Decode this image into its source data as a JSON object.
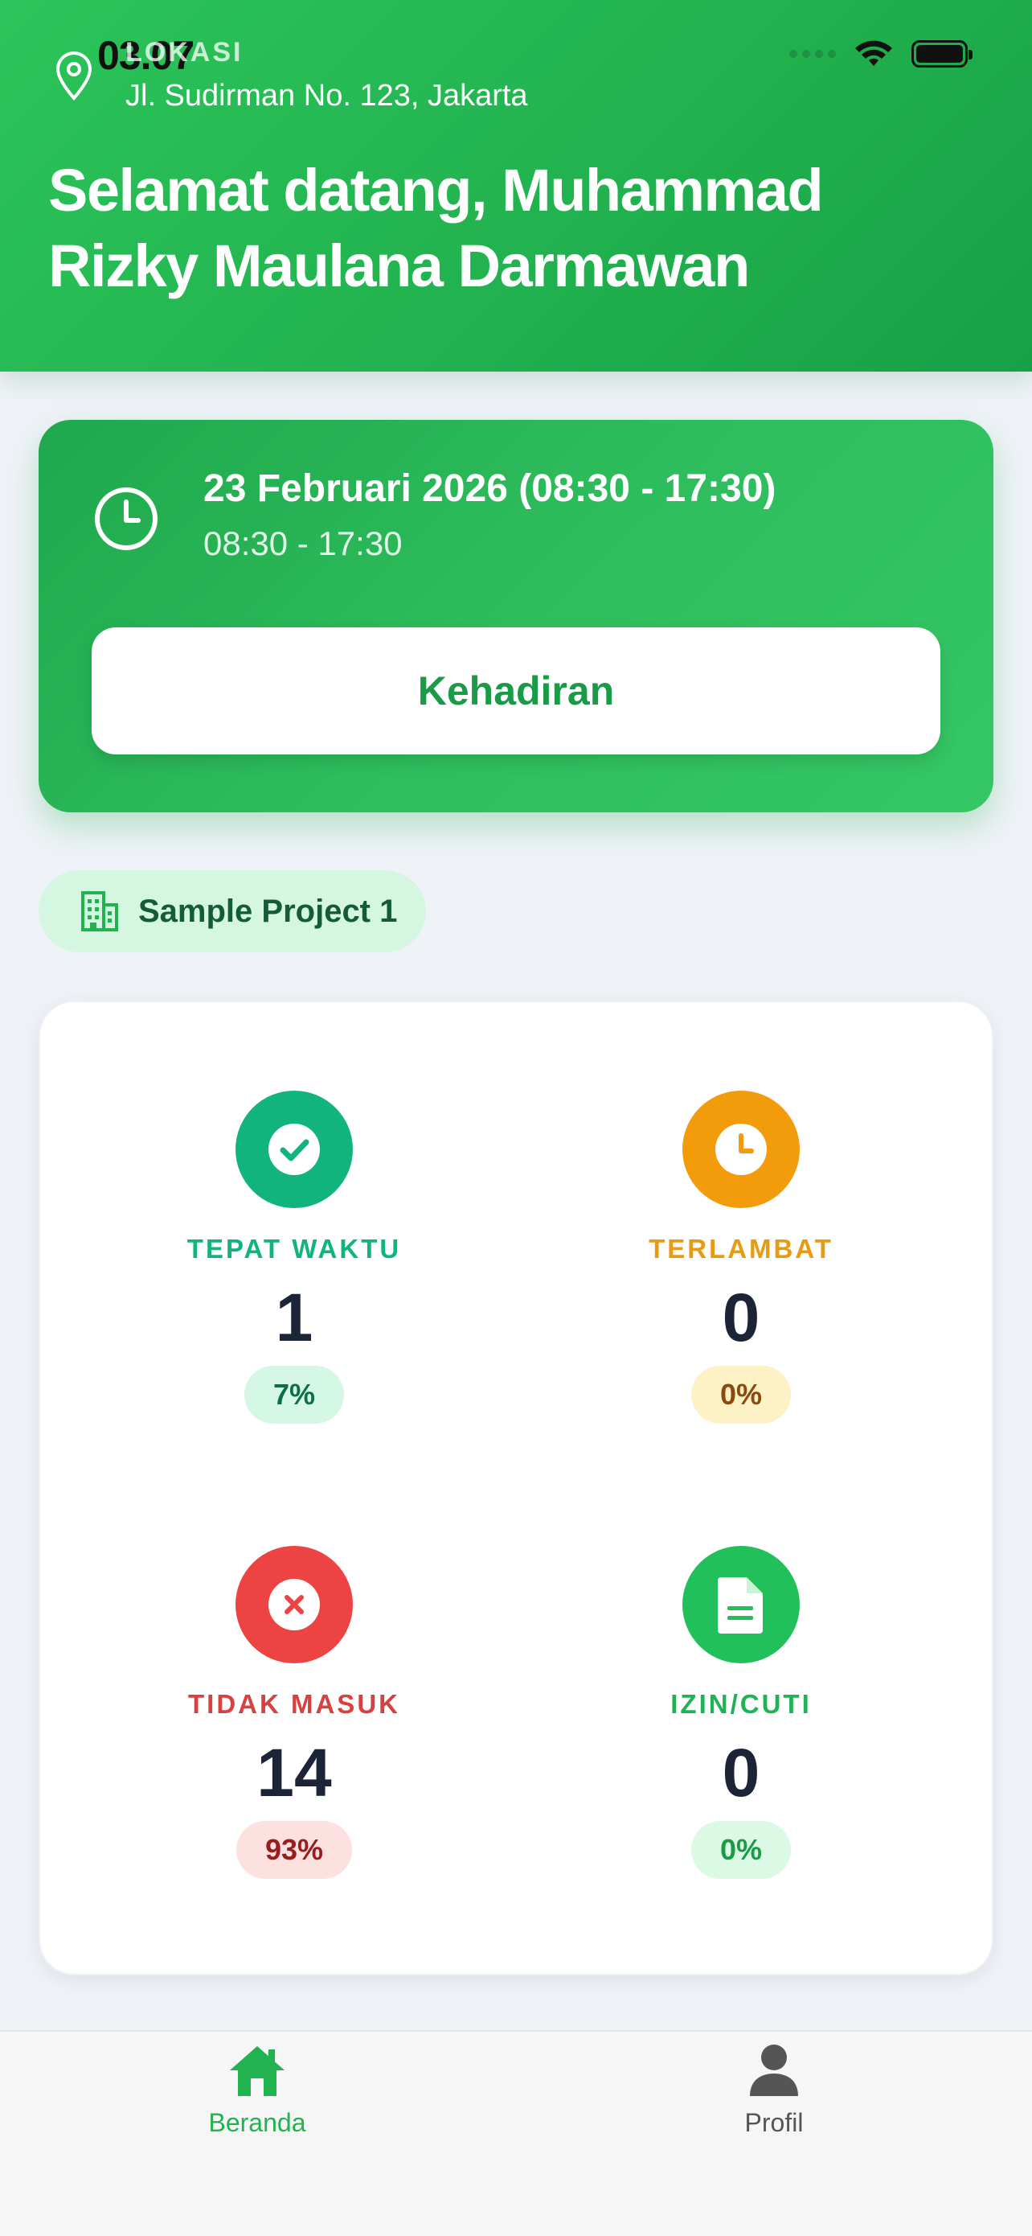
{
  "status_bar": {
    "time": "03.07"
  },
  "location": {
    "label": "LOKASI",
    "address": "Jl. Sudirman No. 123, Jakarta"
  },
  "welcome_text": "Selamat datang, Muhammad Rizky Maulana Darmawan",
  "shift": {
    "date": "23 Februari 2026 (08:30 - 17:30)",
    "hours": "08:30 - 17:30",
    "button_label": "Kehadiran"
  },
  "project": {
    "name": "Sample Project 1"
  },
  "stats": [
    {
      "label": "TEPAT WAKTU",
      "value": "1",
      "percent": "7%",
      "icon": "check-icon",
      "color": "#12b47d"
    },
    {
      "label": "TERLAMBAT",
      "value": "0",
      "percent": "0%",
      "icon": "clock-icon",
      "color": "#f39c0b"
    },
    {
      "label": "TIDAK MASUK",
      "value": "14",
      "percent": "93%",
      "icon": "x-icon",
      "color": "#ee4343"
    },
    {
      "label": "IZIN/CUTI",
      "value": "0",
      "percent": "0%",
      "icon": "document-icon",
      "color": "#22c05a"
    }
  ],
  "tabs": [
    {
      "label": "Beranda",
      "icon": "home-icon",
      "active": true
    },
    {
      "label": "Profil",
      "icon": "person-icon",
      "active": false
    }
  ],
  "colors": {
    "primary": "#22b24f",
    "background": "#eff2f7",
    "text_dark": "#1c2537"
  }
}
